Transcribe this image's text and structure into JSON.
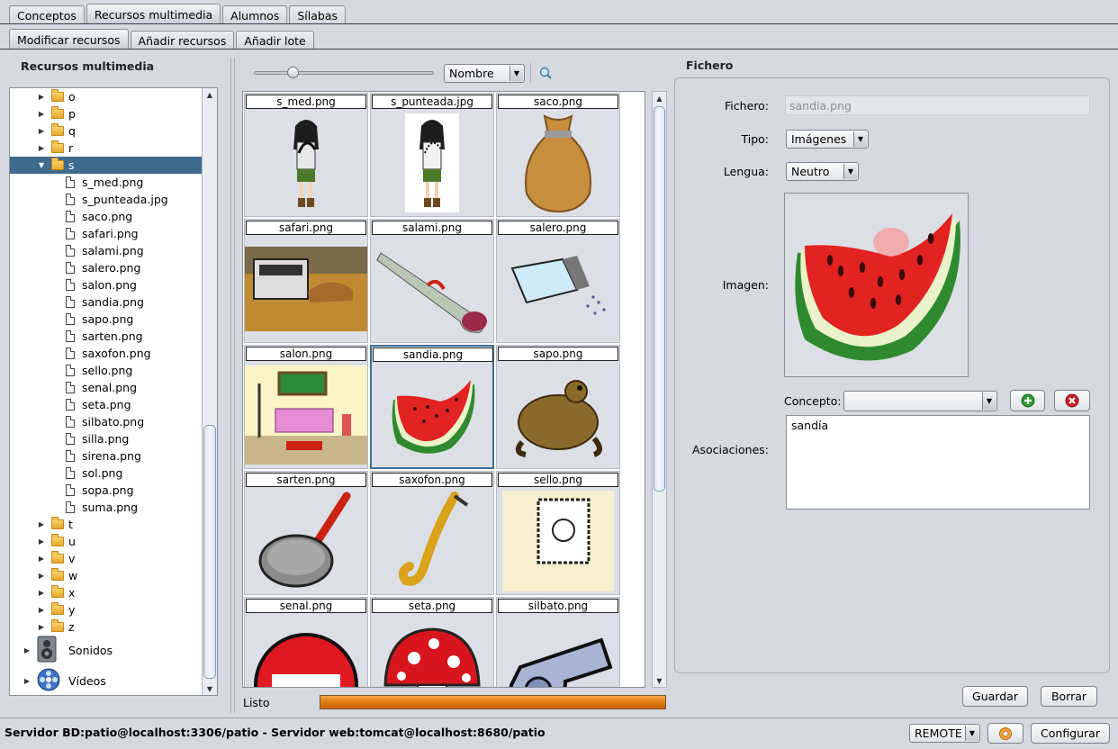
{
  "main_tabs": [
    "Conceptos",
    "Recursos multimedia",
    "Alumnos",
    "Sílabas"
  ],
  "sub_tabs": [
    "Modificar recursos",
    "Añadir recursos",
    "Añadir lote"
  ],
  "left_panel_title": "Recursos multimedia",
  "tree_folders_before": [
    "o",
    "p",
    "q",
    "r"
  ],
  "tree_open_folder": "s",
  "tree_files": [
    "s_med.png",
    "s_punteada.jpg",
    "saco.png",
    "safari.png",
    "salami.png",
    "salero.png",
    "salon.png",
    "sandia.png",
    "sapo.png",
    "sarten.png",
    "saxofon.png",
    "sello.png",
    "senal.png",
    "seta.png",
    "silbato.png",
    "silla.png",
    "sirena.png",
    "sol.png",
    "sopa.png",
    "suma.png"
  ],
  "tree_folders_after": [
    "t",
    "u",
    "v",
    "w",
    "x",
    "y",
    "z"
  ],
  "tree_categories": [
    "Sonidos",
    "Vídeos"
  ],
  "sort_combo": "Nombre",
  "grid_items": [
    "s_med.png",
    "s_punteada.jpg",
    "saco.png",
    "safari.png",
    "salami.png",
    "salero.png",
    "salon.png",
    "sandia.png",
    "sapo.png",
    "sarten.png",
    "saxofon.png",
    "sello.png",
    "senal.png",
    "seta.png",
    "silbato.png"
  ],
  "grid_selected": "sandia.png",
  "status_text": "Listo",
  "right_panel": {
    "title": "Fichero",
    "fichero_label": "Fichero:",
    "fichero_value": "sandia.png",
    "tipo_label": "Tipo:",
    "tipo_value": "Imágenes",
    "lengua_label": "Lengua:",
    "lengua_value": "Neutro",
    "imagen_label": "Imagen:",
    "concepto_label": "Concepto:",
    "concepto_value": "",
    "asociaciones_label": "Asociaciones:",
    "asociaciones_value": "sandía"
  },
  "actions": {
    "guardar": "Guardar",
    "borrar": "Borrar"
  },
  "footer": {
    "server_text": "Servidor BD:patio@localhost:3306/patio - Servidor web:tomcat@localhost:8680/patio",
    "mode": "REMOTE",
    "configurar": "Configurar"
  },
  "colors": {
    "selection": "#3e6a8e",
    "progress": "#e07b10",
    "add": "#2e9a2e",
    "remove": "#c8202a"
  }
}
